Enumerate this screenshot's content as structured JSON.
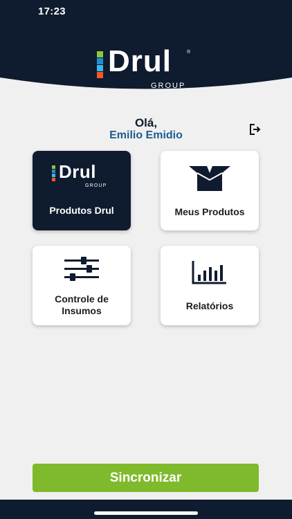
{
  "status_bar": {
    "time": "17:23"
  },
  "brand": {
    "name": "Drul",
    "sub": "GROUP",
    "colors": {
      "navy": "#0f1b2e",
      "green": "#8cc63f",
      "blue": "#1f8fd4",
      "lightblue": "#41b6e6",
      "orange": "#f15a24"
    }
  },
  "greeting": {
    "hello": "Olá,",
    "user_name": "Emilio Emidio"
  },
  "actions": {
    "logout_icon": "logout-icon"
  },
  "menu": {
    "produtos_drul": "Produtos Drul",
    "meus_produtos": "Meus Produtos",
    "controle_insumos_line1": "Controle de",
    "controle_insumos_line2": "Insumos",
    "relatorios": "Relatórios"
  },
  "sync_button": {
    "label": "Sincronizar",
    "color": "#7fba2c"
  },
  "accent": {
    "username_color": "#1d5b91",
    "dark_card": "#0f1b2e"
  }
}
